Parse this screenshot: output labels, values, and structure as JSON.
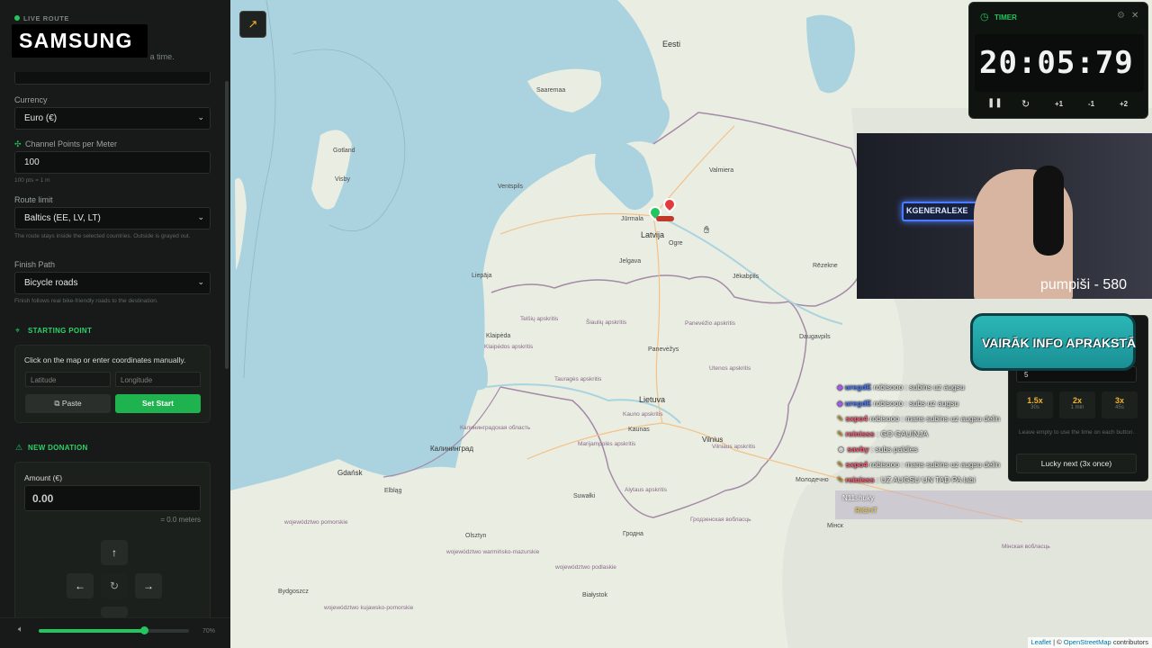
{
  "sidebar": {
    "live_route": "LIVE ROUTE",
    "brand": "SAMSUNG",
    "desc": "Donations share one pool. 1 meter at a time.",
    "currency_label": "Currency",
    "currency_value": "Euro (€)",
    "cp_label": "Channel Points per Meter",
    "cp_value": "100",
    "cp_hint": "100 pts = 1 m",
    "route_limit_label": "Route limit",
    "route_limit_value": "Baltics (EE, LV, LT)",
    "route_limit_hint": "The route stays inside the selected countries. Outside is grayed out.",
    "finish_path_label": "Finish Path",
    "finish_path_value": "Bicycle roads",
    "finish_path_hint": "Finish follows real bike-friendly roads to the destination.",
    "starting_point": {
      "heading": "STARTING POINT",
      "instructions": "Click on the map or enter coordinates manually.",
      "lat_placeholder": "Latitude",
      "lon_placeholder": "Longitude",
      "paste_label": "Paste",
      "set_start_label": "Set Start"
    },
    "new_donation": {
      "heading": "NEW DONATION",
      "amount_label": "Amount (€)",
      "amount_value": "0.00",
      "meters": "= 0.0 meters"
    },
    "volume": {
      "percent_text": "70%",
      "level": 0.7
    }
  },
  "map": {
    "countries": {
      "estonia": "Eesti",
      "latvia": "Latvija",
      "lithuania": "Lietuva"
    },
    "cities": [
      "Saaremaa",
      "Gotland",
      "Visby",
      "Ventspils",
      "Jūrmala",
      "Ogre",
      "Valmiera",
      "Jelgava",
      "Jēkabpils",
      "Rēzekne",
      "Liepāja",
      "Daugavpils",
      "Panevėžys",
      "Kaunas",
      "Vilnius",
      "Klaipėda",
      "Gdańsk",
      "Elbląg",
      "Калининград",
      "Olsztyn",
      "Suwałki",
      "Białystok",
      "Гродна",
      "Bydgoszcz",
      "Мінск",
      "Молодечно"
    ],
    "regions": [
      "Telšių apskritis",
      "Šiaulių apskritis",
      "Panevėžio apskritis",
      "Utenos apskritis",
      "Tauragės apskritis",
      "Kauno apskritis",
      "Marijampolės apskritis",
      "Alytaus apskritis",
      "Vilniaus apskritis",
      "Klaipėdos apskritis",
      "Калининградская область",
      "województwo pomorskie",
      "województwo warmińsko-mazurskie",
      "województwo podlaskie",
      "województwo kujawsko-pomorskie",
      "Гродзенская вобласць",
      "Мінская вобласць"
    ],
    "attribution": {
      "leaflet": "Leaflet",
      "osm": "OpenStreetMap",
      "suffix": "contributors"
    }
  },
  "timer": {
    "title": "TIMER",
    "time": "20:05:79",
    "buttons": [
      "+1",
      "-1",
      "+2"
    ]
  },
  "stream_overlay": {
    "webcam_caption": "pumpiši - 580",
    "webcam_sign": "KGENERALEXE",
    "banner": "VAIRĀK INFO APRAKSTĀ"
  },
  "multiplier_panel": {
    "input_value": "5",
    "options": [
      {
        "label": "1.5x",
        "sub": "30s"
      },
      {
        "label": "2x",
        "sub": "1 min"
      },
      {
        "label": "3x",
        "sub": "45s"
      }
    ],
    "hint": "Leave empty to use the time on each button.",
    "lucky_label": "Lucky next (3x once)"
  },
  "chat": [
    {
      "user": "uregdE",
      "text": "robisooo : subins uz augsu"
    },
    {
      "user": "uregdE",
      "text": "robisooo : subs uz augsu"
    },
    {
      "user": "sxpo4",
      "text": "robisooo : mans subins uz augsu delin"
    },
    {
      "user": "reinisss",
      "text": ": GO GAUINJA"
    },
    {
      "user": "savby",
      "text": ": subs paldies"
    },
    {
      "user": "sxpo4",
      "text": "robisooo : mans subins uz augsu delin"
    },
    {
      "user": "reinisss",
      "text": ": UZ AUGSU UN TAD PA labi"
    }
  ],
  "chat_event": {
    "user": "N11shuky",
    "text": "RIGHT"
  },
  "colors": {
    "accent": "#22c55e",
    "sidebar_bg": "#171a18",
    "water": "#aad3df",
    "land": "#e7ecdf"
  }
}
